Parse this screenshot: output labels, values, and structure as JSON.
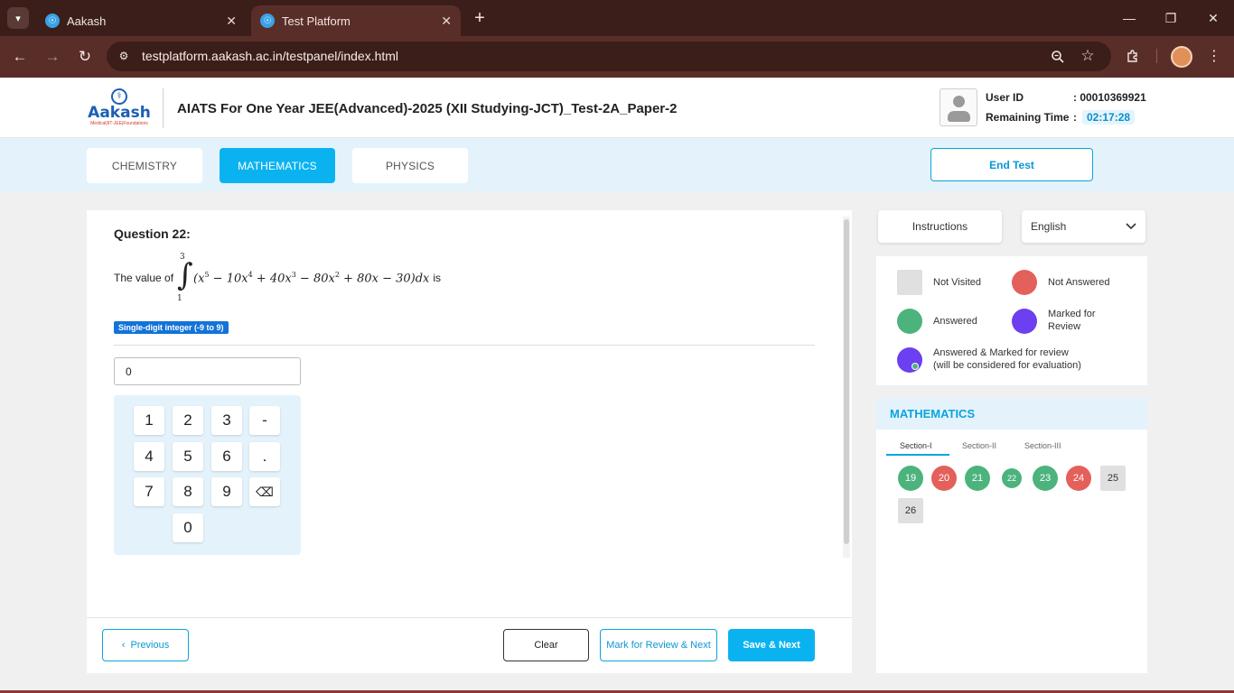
{
  "browser": {
    "tabs": [
      {
        "title": "Aakash",
        "active": false
      },
      {
        "title": "Test Platform",
        "active": true
      }
    ],
    "url": "testplatform.aakash.ac.in/testpanel/index.html"
  },
  "header": {
    "logo": {
      "word": "Aakash",
      "sub": "Medical|IIT-JEE|Foundations"
    },
    "test_title": "AIATS For One Year JEE(Advanced)-2025 (XII Studying-JCT)_Test-2A_Paper-2",
    "user_id_label": "User ID",
    "user_id_value": ": 00010369921",
    "remaining_time_label": "Remaining Time",
    "remaining_time_sep": ":",
    "remaining_time_value": "02:17:28"
  },
  "subjects": {
    "tabs": [
      {
        "label": "CHEMISTRY",
        "active": false
      },
      {
        "label": "MATHEMATICS",
        "active": true
      },
      {
        "label": "PHYSICS",
        "active": false
      }
    ],
    "end_test_label": "End Test"
  },
  "question": {
    "label": "Question 22:",
    "text_prefix": "The value of",
    "integral_upper": "3",
    "integral_lower": "1",
    "text_suffix": "is",
    "type_badge": "Single-digit integer (-9 to 9)",
    "answer_value": "0"
  },
  "keypad": {
    "keys": [
      "1",
      "2",
      "3",
      "-",
      "4",
      "5",
      "6",
      ".",
      "7",
      "8",
      "9",
      "⌫",
      "0"
    ]
  },
  "footer": {
    "previous_label": "Previous",
    "clear_label": "Clear",
    "mark_label": "Mark for Review & Next",
    "save_label": "Save & Next"
  },
  "side": {
    "instructions_label": "Instructions",
    "language_value": "English"
  },
  "legend": {
    "not_visited": "Not Visited",
    "not_answered": "Not Answered",
    "answered": "Answered",
    "marked_line1": "Marked for",
    "marked_line2": "Review",
    "answered_marked_line1": "Answered & Marked for review",
    "answered_marked_line2": "(will be considered for evaluation)"
  },
  "palette": {
    "title": "MATHEMATICS",
    "sections": [
      "Section-I",
      "Section-II",
      "Section-III"
    ],
    "questions": [
      {
        "num": "19",
        "status": "answered"
      },
      {
        "num": "20",
        "status": "not_answered"
      },
      {
        "num": "21",
        "status": "answered"
      },
      {
        "num": "22",
        "status": "answered",
        "current": true
      },
      {
        "num": "23",
        "status": "answered"
      },
      {
        "num": "24",
        "status": "not_answered"
      },
      {
        "num": "25",
        "status": "not_visited"
      },
      {
        "num": "26",
        "status": "not_visited"
      }
    ]
  },
  "colors": {
    "accent": "#0ab3f0",
    "answered": "#4cb37d",
    "not_answered": "#e4605a",
    "marked": "#6c3ff0",
    "not_visited": "#e0e0e0"
  }
}
